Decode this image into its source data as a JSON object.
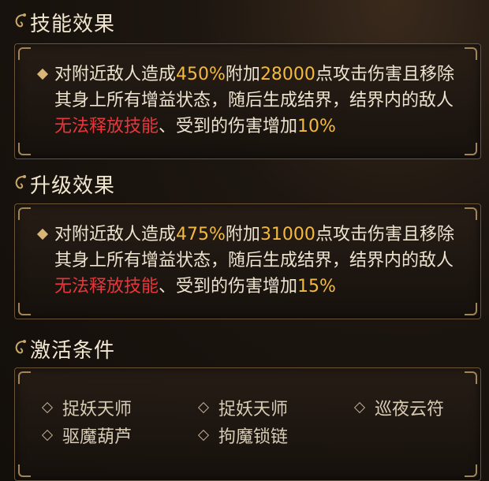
{
  "skill_section": {
    "title": "技能效果",
    "text": {
      "p1": "对附近敌人造成",
      "pct": "450%",
      "p2": "附加",
      "dmg": "28000",
      "p3": "点攻击伤害且移除其身上所有增益状态，随后生成结界，结界内的敌人",
      "red": "无法释放技能",
      "p4": "、受到的伤害增加",
      "inc": "10%"
    }
  },
  "upgrade_section": {
    "title": "升级效果",
    "text": {
      "p1": "对附近敌人造成",
      "pct": "475%",
      "p2": "附加",
      "dmg": "31000",
      "p3": "点攻击伤害且移除其身上所有增益状态，随后生成结界，结界内的敌人",
      "red": "无法释放技能",
      "p4": "、受到的伤害增加",
      "inc": "15%"
    }
  },
  "activation_section": {
    "title": "激活条件",
    "items": [
      "捉妖天师",
      "捉妖天师",
      "巡夜云符",
      "驱魔葫芦",
      "拘魔锁链"
    ]
  },
  "colors": {
    "gold": "#f3b940",
    "red": "#e8363c",
    "border": "#6b5437"
  }
}
